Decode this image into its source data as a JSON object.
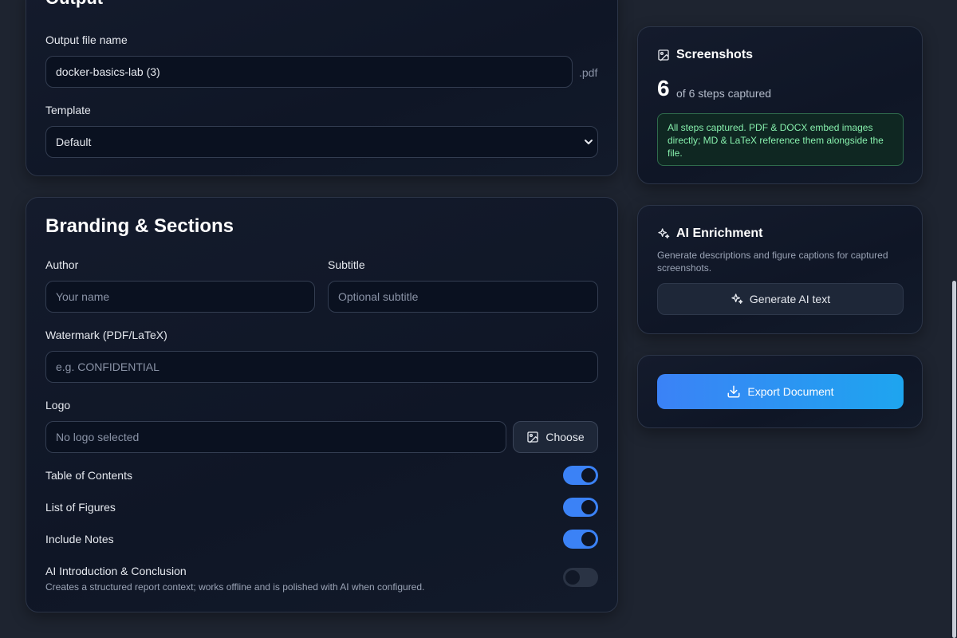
{
  "output": {
    "title": "Output",
    "filename_label": "Output file name",
    "filename_value": "docker-basics-lab (3)",
    "filename_ext": ".pdf",
    "template_label": "Template",
    "template_value": "Default"
  },
  "branding": {
    "title": "Branding & Sections",
    "author_label": "Author",
    "author_placeholder": "Your name",
    "subtitle_label": "Subtitle",
    "subtitle_placeholder": "Optional subtitle",
    "watermark_label": "Watermark (PDF/LaTeX)",
    "watermark_placeholder": "e.g. CONFIDENTIAL",
    "logo_label": "Logo",
    "logo_placeholder": "No logo selected",
    "choose_label": "Choose",
    "toc_label": "Table of Contents",
    "lof_label": "List of Figures",
    "notes_label": "Include Notes",
    "ai_intro_label": "AI Introduction & Conclusion",
    "ai_intro_desc": "Creates a structured report context; works offline and is polished with AI when configured."
  },
  "toggles": {
    "toc": true,
    "lof": true,
    "notes": true,
    "ai_intro": false
  },
  "screenshots": {
    "title": "Screenshots",
    "count": "6",
    "count_text": "of 6 steps captured",
    "notice": "All steps captured. PDF & DOCX embed images directly; MD & LaTeX reference them alongside the file."
  },
  "ai": {
    "title": "AI Enrichment",
    "desc": "Generate descriptions and figure captions for captured screenshots.",
    "button": "Generate AI text"
  },
  "export": {
    "button": "Export Document"
  },
  "icons": {
    "screenshots": "image-icon",
    "ai": "sparkles-icon",
    "choose": "image-icon",
    "export": "download-icon"
  },
  "colors": {
    "accent": "#3b82f6",
    "success_text": "#86efac",
    "success_border": "#2f6b4c"
  }
}
